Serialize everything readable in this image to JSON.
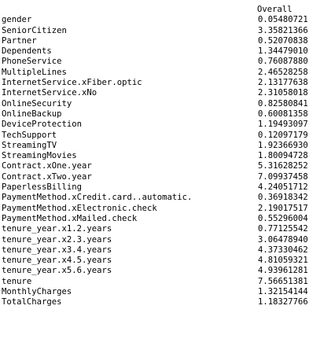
{
  "console": {
    "partial_top_text": "",
    "column_header": "Overall",
    "rows": [
      {
        "name": "gender",
        "value": "0.05480721"
      },
      {
        "name": "SeniorCitizen",
        "value": "3.35821366"
      },
      {
        "name": "Partner",
        "value": "0.52070838"
      },
      {
        "name": "Dependents",
        "value": "1.34479010"
      },
      {
        "name": "PhoneService",
        "value": "0.76087880"
      },
      {
        "name": "MultipleLines",
        "value": "2.46528258"
      },
      {
        "name": "InternetService.xFiber.optic",
        "value": "2.13177638"
      },
      {
        "name": "InternetService.xNo",
        "value": "2.31058018"
      },
      {
        "name": "OnlineSecurity",
        "value": "0.82580841"
      },
      {
        "name": "OnlineBackup",
        "value": "0.60081358"
      },
      {
        "name": "DeviceProtection",
        "value": "1.19493097"
      },
      {
        "name": "TechSupport",
        "value": "0.12097179"
      },
      {
        "name": "StreamingTV",
        "value": "1.92366930"
      },
      {
        "name": "StreamingMovies",
        "value": "1.80094728"
      },
      {
        "name": "Contract.xOne.year",
        "value": "5.31628252"
      },
      {
        "name": "Contract.xTwo.year",
        "value": "7.09937458"
      },
      {
        "name": "PaperlessBilling",
        "value": "4.24051712"
      },
      {
        "name": "PaymentMethod.xCredit.card..automatic.",
        "value": "0.36918342"
      },
      {
        "name": "PaymentMethod.xElectronic.check",
        "value": "2.19017517"
      },
      {
        "name": "PaymentMethod.xMailed.check",
        "value": "0.55296004"
      },
      {
        "name": "tenure_year.x1.2.years",
        "value": "0.77125542"
      },
      {
        "name": "tenure_year.x2.3.years",
        "value": "3.06478940"
      },
      {
        "name": "tenure_year.x3.4.years",
        "value": "4.37330462"
      },
      {
        "name": "tenure_year.x4.5.years",
        "value": "4.81059321"
      },
      {
        "name": "tenure_year.x5.6.years",
        "value": "4.93961281"
      },
      {
        "name": "tenure",
        "value": "7.56651381"
      },
      {
        "name": "MonthlyCharges",
        "value": "1.32154144"
      },
      {
        "name": "TotalCharges",
        "value": "1.18327766"
      }
    ]
  }
}
